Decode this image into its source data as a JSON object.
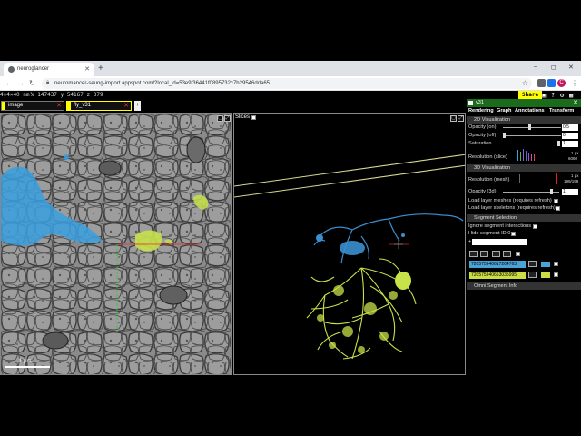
{
  "browser": {
    "tab_title": "neuroglancer",
    "new_tab": "+",
    "window_controls": {
      "minimize": "–",
      "maximize": "◻",
      "close": "✕"
    },
    "url": "neuromancer-seung-import.appspot.com/?local_id=53e9f36441f0895732c7b29546dda65",
    "nav": {
      "back": "←",
      "forward": "→",
      "reload": "↻"
    },
    "star": "☆",
    "profile_letter": "C"
  },
  "ng_top": {
    "resolution": "4×4×40 nm³",
    "x_label": "x",
    "x_value": "147437",
    "y_label": "y",
    "y_value": "54167",
    "z_label": "z",
    "z_value": "379",
    "share_label": "Share"
  },
  "layers": [
    {
      "name": "image",
      "color": "#ffff00",
      "close": "✕"
    },
    {
      "name": "fly_v31",
      "color": "#ffff00",
      "close": "✕"
    }
  ],
  "add_layer": "+",
  "left_panel": {
    "scale_label": "1 µm"
  },
  "right_panel": {
    "slices_label": "Slices"
  },
  "side": {
    "layer_name": "v31",
    "close": "✕",
    "tabs": [
      "Rendering",
      "Graph",
      "Annotations",
      "Transform"
    ],
    "sec_2d": "2D Visualization",
    "opacity_on_label": "Opacity (on)",
    "opacity_on_value": "0.5",
    "opacity_off_label": "Opacity (off)",
    "opacity_off_value": "0",
    "saturation_label": "Saturation",
    "saturation_value": "1",
    "resolution_slice_label": "Resolution (slice)",
    "res_slice_top": "1 px",
    "res_slice_bottom": "6060",
    "sec_3d": "3D Visualization",
    "resolution_mesh_label": "Resolution (mesh)",
    "res_mesh_top": "1 px",
    "res_mesh_bottom": "199/199",
    "opacity_3d_label": "Opacity (3d)",
    "opacity_3d_value": "1",
    "load_meshes": "Load layer meshes (requires refresh)",
    "load_skeletons": "Load layer skeletons (requires refresh)",
    "sec_segsel": "Segment Selection",
    "ignore_interactions": "Ignore segment interactions",
    "hide_segment": "Hide segment ID 0",
    "segment_input_prefix": "+",
    "segments": [
      {
        "id": "720575940617264763",
        "color": "#4aa3d8"
      },
      {
        "id": "720575940653035995",
        "color": "#ccdd44"
      }
    ],
    "sec_omni": "Omni Segment Info"
  },
  "colors": {
    "accent_green": "#1a6b1a",
    "segment_blue": "#3aa0e0",
    "segment_yellow": "#c8e24a",
    "share_yellow": "#ffff00"
  }
}
